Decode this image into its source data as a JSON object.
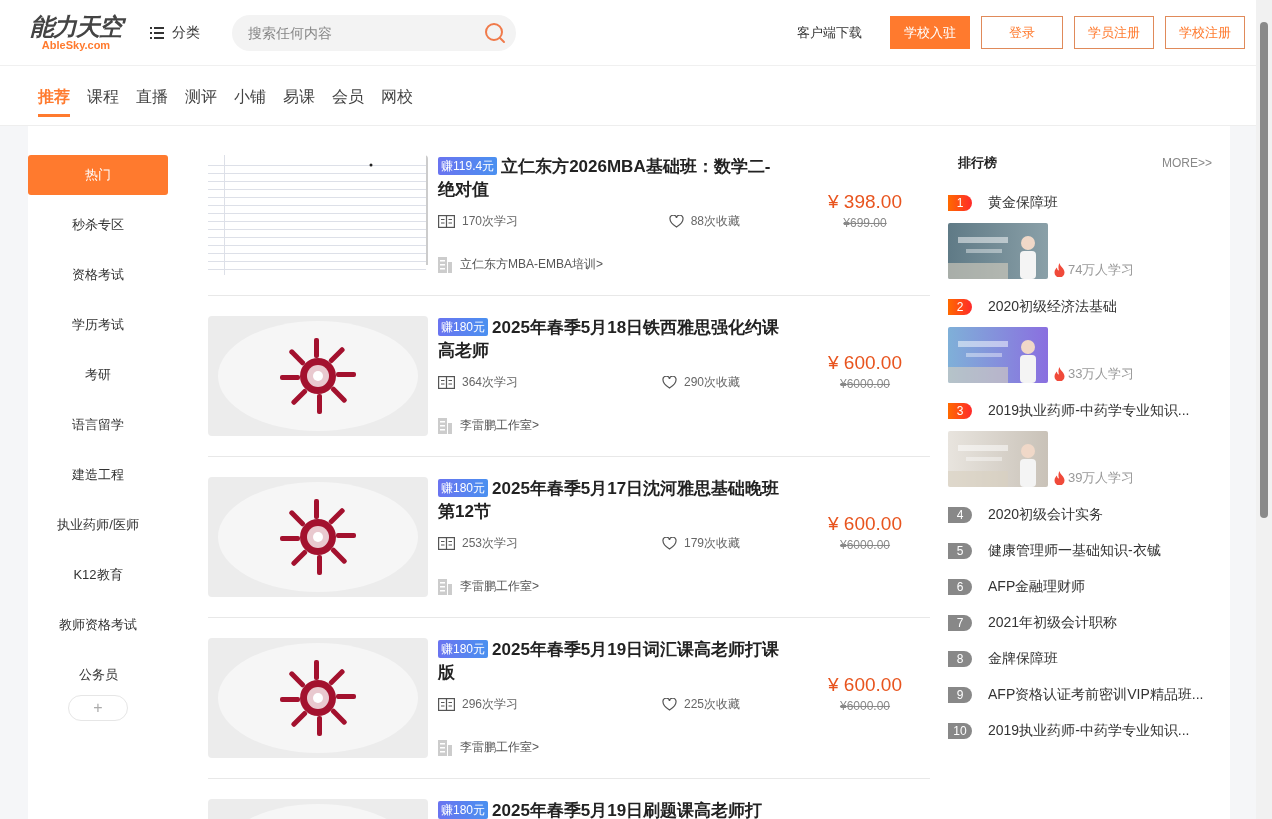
{
  "header": {
    "logo_main": "能力天空",
    "logo_sub": "AbleSky.com",
    "category_label": "分类",
    "search": {
      "placeholder": "搜索任何内容"
    },
    "download_link": "客户端下载",
    "buttons": [
      {
        "label": "学校入驻",
        "kind": "primary"
      },
      {
        "label": "登录",
        "kind": "outline"
      },
      {
        "label": "学员注册",
        "kind": "outline"
      },
      {
        "label": "学校注册",
        "kind": "outline"
      }
    ]
  },
  "nav_tabs": [
    {
      "label": "推荐",
      "selected": true
    },
    {
      "label": "课程",
      "selected": false
    },
    {
      "label": "直播",
      "selected": false
    },
    {
      "label": "测评",
      "selected": false
    },
    {
      "label": "小铺",
      "selected": false
    },
    {
      "label": "易课",
      "selected": false
    },
    {
      "label": "会员",
      "selected": false
    },
    {
      "label": "网校",
      "selected": false
    }
  ],
  "sidebar": {
    "items": [
      {
        "label": "热门",
        "selected": true
      },
      {
        "label": "秒杀专区",
        "selected": false
      },
      {
        "label": "资格考试",
        "selected": false
      },
      {
        "label": "学历考试",
        "selected": false
      },
      {
        "label": "考研",
        "selected": false
      },
      {
        "label": "语言留学",
        "selected": false
      },
      {
        "label": "建造工程",
        "selected": false
      },
      {
        "label": "执业药师/医师",
        "selected": false
      },
      {
        "label": "K12教育",
        "selected": false
      },
      {
        "label": "教师资格考试",
        "selected": false
      },
      {
        "label": "公务员",
        "selected": false
      }
    ],
    "more_button": "+"
  },
  "courses": [
    {
      "badge": "赚119.4元",
      "title": "立仁东方2026MBA基础班：数学二-绝对值",
      "learners": "170次学习",
      "favorites": "88次收藏",
      "provider": "立仁东方MBA-EMBA培训>",
      "price": "¥ 398.00",
      "original_price": "¥699.00"
    },
    {
      "badge": "赚180元",
      "title": "2025年春季5月18日铁西雅思强化约课高老师",
      "learners": "364次学习",
      "favorites": "290次收藏",
      "provider": "李雷鹏工作室>",
      "price": "¥ 600.00",
      "original_price": "¥6000.00"
    },
    {
      "badge": "赚180元",
      "title": "2025年春季5月17日沈河雅思基础晚班第12节",
      "learners": "253次学习",
      "favorites": "179次收藏",
      "provider": "李雷鹏工作室>",
      "price": "¥ 600.00",
      "original_price": "¥6000.00"
    },
    {
      "badge": "赚180元",
      "title": "2025年春季5月19日词汇课高老师打课版",
      "learners": "296次学习",
      "favorites": "225次收藏",
      "provider": "李雷鹏工作室>",
      "price": "¥ 600.00",
      "original_price": "¥6000.00"
    },
    {
      "badge": "赚180元",
      "title": "2025年春季5月19日刷题课高老师打"
    }
  ],
  "ranking": {
    "title": "排行榜",
    "more_link": "MORE>>",
    "items": [
      {
        "rank": "1",
        "name": "黄金保障班",
        "kind": "featured",
        "learners": "74万人学习"
      },
      {
        "rank": "2",
        "name": "2020初级经济法基础",
        "kind": "featured",
        "learners": "33万人学习"
      },
      {
        "rank": "3",
        "name": "2019执业药师-中药学专业知识...",
        "kind": "featured",
        "learners": "39万人学习"
      },
      {
        "rank": "4",
        "name": "2020初级会计实务",
        "kind": "plain"
      },
      {
        "rank": "5",
        "name": "健康管理师一基础知识-衣铖",
        "kind": "plain"
      },
      {
        "rank": "6",
        "name": "AFP金融理财师",
        "kind": "plain"
      },
      {
        "rank": "7",
        "name": "2021年初级会计职称",
        "kind": "plain"
      },
      {
        "rank": "8",
        "name": "金牌保障班",
        "kind": "plain"
      },
      {
        "rank": "9",
        "name": "AFP资格认证考前密训VIP精品班...",
        "kind": "plain"
      },
      {
        "rank": "10",
        "name": "2019执业药师-中药学专业知识...",
        "kind": "plain"
      }
    ]
  }
}
